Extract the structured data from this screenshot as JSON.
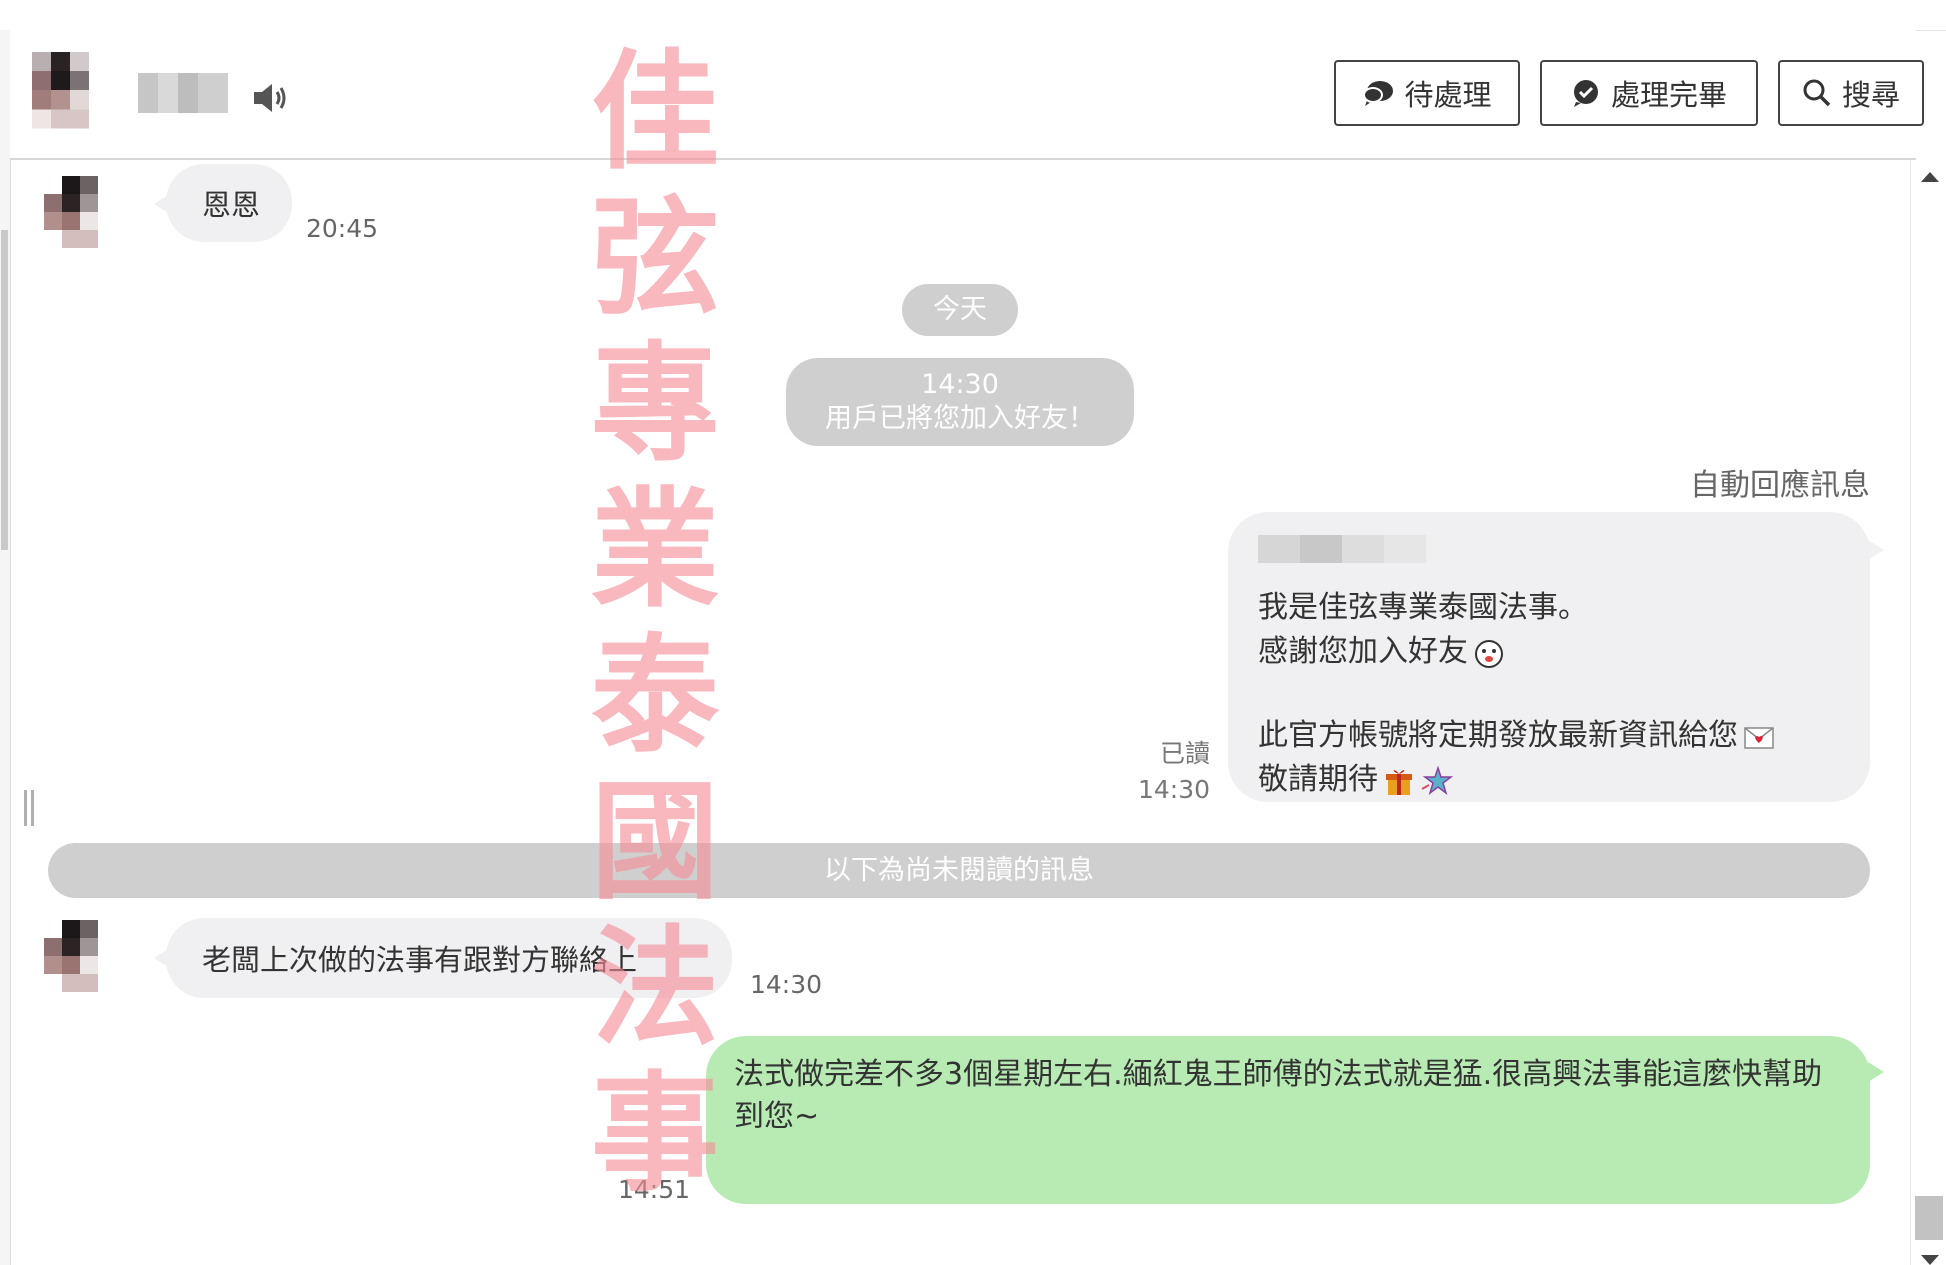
{
  "header": {
    "buttons": {
      "pending": "待處理",
      "done": "處理完畢",
      "search": "搜尋"
    }
  },
  "messages": {
    "first": {
      "text": "恩恩",
      "time": "20:45"
    },
    "date_divider": "今天",
    "system": {
      "time": "14:30",
      "text": "用戶已將您加入好友！"
    },
    "auto_reply": {
      "label": "自動回應訊息",
      "line1": "我是佳弦專業泰國法事。",
      "line2": "感謝您加入好友",
      "line3": "此官方帳號將定期發放最新資訊給您",
      "line4": "敬請期待",
      "read": "已讀",
      "time": "14:30"
    },
    "unread_divider": "以下為尚未閱讀的訊息",
    "customer": {
      "text": "老闆上次做的法事有跟對方聯絡上",
      "time": "14:30"
    },
    "reply": {
      "text": "法式做完差不多3個星期左右.緬紅鬼王師傅的法式就是猛.很高興法事能這麼快幫助到您~",
      "time": "14:51"
    }
  },
  "watermark": [
    "佳",
    "弦",
    "專",
    "業",
    "泰",
    "國",
    "法",
    "事"
  ],
  "colors": {
    "incoming_bubble": "#f0f0f2",
    "outgoing_bubble": "#b8ebb4",
    "pill": "#cfcfcf",
    "watermark": "#f68c96"
  },
  "icons": {
    "pending": "speech-bubble-icon",
    "done": "check-circle-icon",
    "search": "search-icon",
    "speaker": "speaker-icon"
  }
}
